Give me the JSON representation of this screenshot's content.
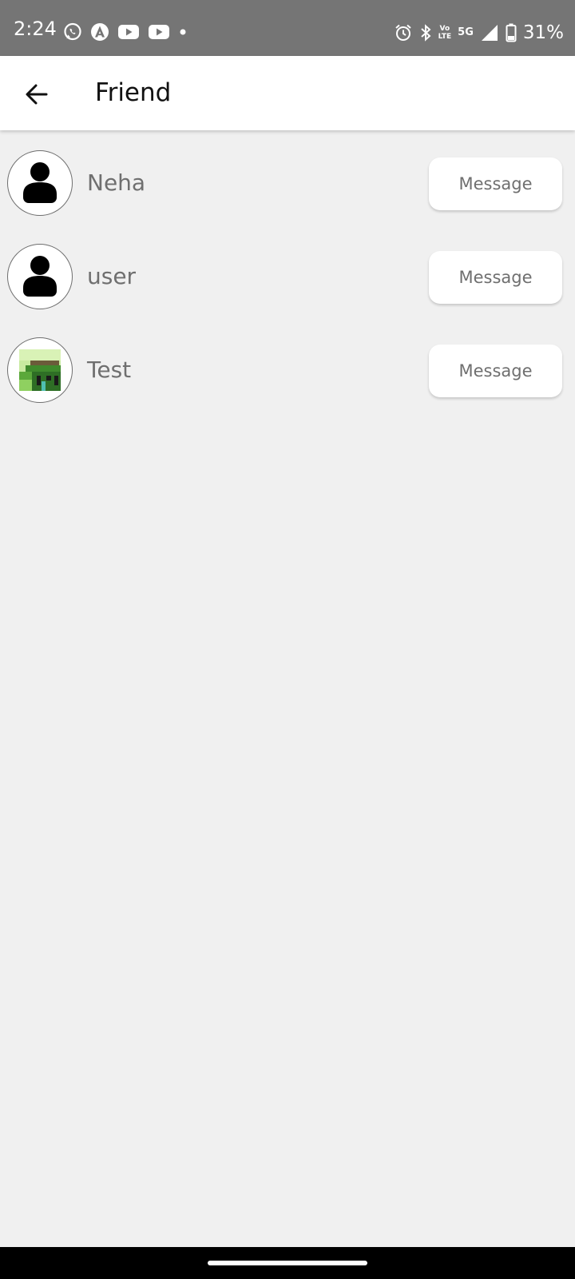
{
  "status_bar": {
    "time": "2:24",
    "left_icons": [
      "whatsapp-icon",
      "arc-app-icon",
      "youtube-icon",
      "youtube-icon",
      "dot-icon"
    ],
    "right_icons": [
      "alarm-icon",
      "bluetooth-icon",
      "volte-icon",
      "5g-icon",
      "signal-icon",
      "battery-icon"
    ],
    "vo_label": "Vo",
    "lte_label": "LTE",
    "network_label": "5G",
    "battery_percent": "31%"
  },
  "app_bar": {
    "title": "Friend",
    "back_icon": "arrow-left-icon"
  },
  "friends": [
    {
      "name": "Neha",
      "avatar": "default-person-icon",
      "button_label": "Message"
    },
    {
      "name": "user",
      "avatar": "default-person-icon",
      "button_label": "Message"
    },
    {
      "name": "Test",
      "avatar": "photo-thumbnail",
      "button_label": "Message"
    }
  ],
  "colors": {
    "status_bar_bg": "#757575",
    "app_bar_bg": "#ffffff",
    "page_bg": "#f0f0f0",
    "name_text": "#6f6f6f",
    "nav_bar_bg": "#000000"
  }
}
